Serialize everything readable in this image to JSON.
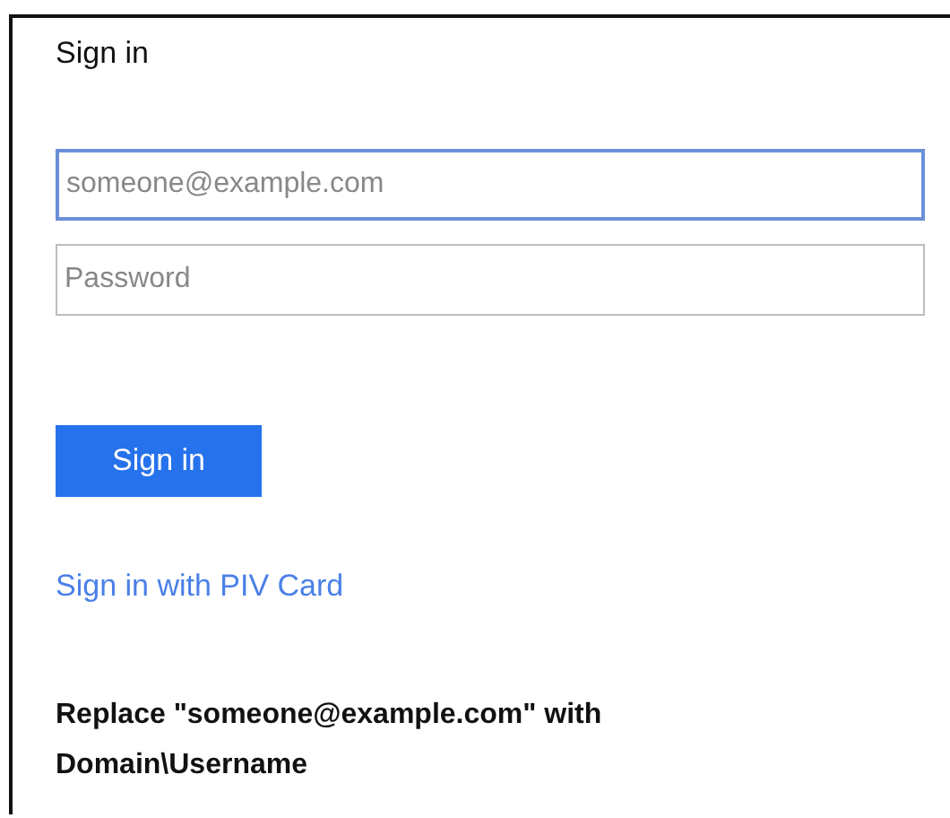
{
  "title": "Sign in",
  "fields": [
    {
      "placeholder": "someone@example.com",
      "focused": true
    },
    {
      "placeholder": "Password",
      "focused": false
    }
  ],
  "button": "Sign in",
  "link": "Sign in with PIV Card",
  "note": "Replace \"someone@example.com\" with Domain\\Username"
}
